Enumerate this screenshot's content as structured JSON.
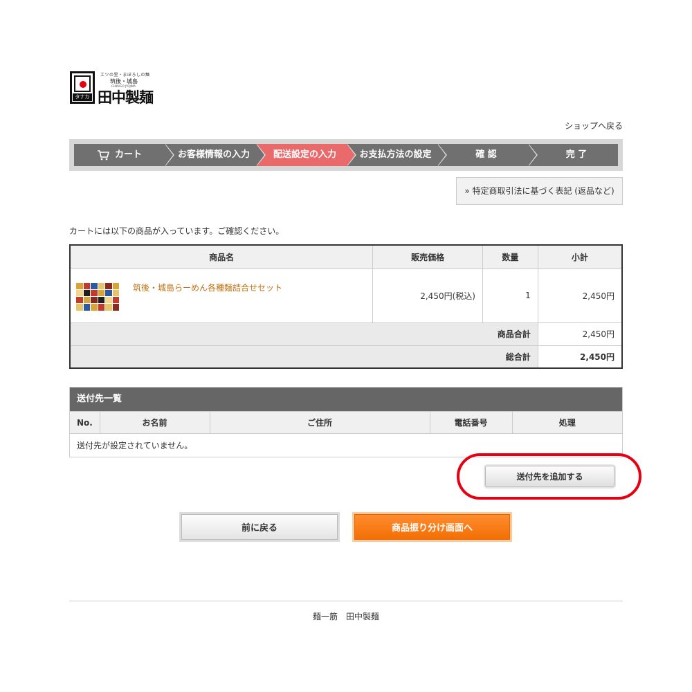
{
  "logo": {
    "tagline": "エツの里・まぼろしの麺",
    "sub": "筑後・城島",
    "romaji": "CHIKUGO JYOJIMA",
    "kana": "タナカ",
    "name": "田中製麺"
  },
  "header": {
    "back_to_shop": "ショップへ戻る"
  },
  "steps": [
    {
      "label": "カート",
      "active": false
    },
    {
      "label": "お客様情報の入力",
      "active": false
    },
    {
      "label": "配送設定の入力",
      "active": true
    },
    {
      "label": "お支払方法の設定",
      "active": false
    },
    {
      "label": "確 認",
      "active": false
    },
    {
      "label": "完 了",
      "active": false
    }
  ],
  "legal_link": "» 特定商取引法に基づく表記 (返品など)",
  "intro": "カートには以下の商品が入っています。ご確認ください。",
  "cart": {
    "headers": [
      "商品名",
      "販売価格",
      "数量",
      "小計"
    ],
    "items": [
      {
        "name": "筑後・城島らーめん各種麺詰合せセット",
        "price": "2,450円(税込)",
        "qty": "1",
        "subtotal": "2,450円"
      }
    ],
    "product_total_label": "商品合計",
    "product_total": "2,450円",
    "grand_total_label": "総合計",
    "grand_total": "2,450円"
  },
  "addresses": {
    "title": "送付先一覧",
    "headers": [
      "No.",
      "お名前",
      "ご住所",
      "電話番号",
      "処理"
    ],
    "empty": "送付先が設定されていません。",
    "add_button": "送付先を追加する"
  },
  "actions": {
    "back": "前に戻る",
    "next": "商品振り分け画面へ"
  },
  "footer": "麺一筋　田中製麺",
  "colors": {
    "active_step": "#e96a6a",
    "step": "#707070",
    "primary_button": "#f26f05",
    "highlight": "#e60012",
    "item_link": "#c17010"
  }
}
